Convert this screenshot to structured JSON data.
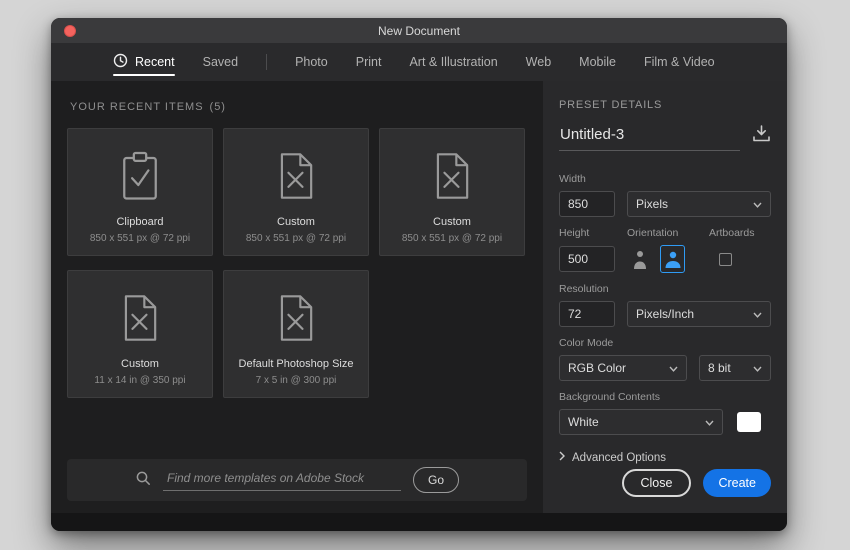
{
  "window": {
    "title": "New Document"
  },
  "tabs": {
    "items": [
      {
        "label": "Recent"
      },
      {
        "label": "Saved"
      },
      {
        "label": "Photo"
      },
      {
        "label": "Print"
      },
      {
        "label": "Art & Illustration"
      },
      {
        "label": "Web"
      },
      {
        "label": "Mobile"
      },
      {
        "label": "Film & Video"
      }
    ]
  },
  "recent": {
    "heading": "YOUR RECENT ITEMS",
    "count": "(5)",
    "items": [
      {
        "title": "Clipboard",
        "subtitle": "850 x 551 px @ 72 ppi",
        "icon": "clipboard-icon"
      },
      {
        "title": "Custom",
        "subtitle": "850 x 551 px @ 72 ppi",
        "icon": "new-document-icon"
      },
      {
        "title": "Custom",
        "subtitle": "850 x 551 px @ 72 ppi",
        "icon": "new-document-icon"
      },
      {
        "title": "Custom",
        "subtitle": "11 x 14 in @ 350 ppi",
        "icon": "new-document-icon"
      },
      {
        "title": "Default Photoshop Size",
        "subtitle": "7 x 5 in @ 300 ppi",
        "icon": "new-document-icon"
      }
    ],
    "search": {
      "placeholder": "Find more templates on Adobe Stock",
      "go_label": "Go"
    }
  },
  "preset": {
    "heading": "PRESET DETAILS",
    "name": "Untitled-3",
    "width": {
      "label": "Width",
      "value": "850",
      "unit": "Pixels"
    },
    "height": {
      "label": "Height",
      "value": "500"
    },
    "orientation": {
      "label": "Orientation",
      "selected": "landscape"
    },
    "artboards": {
      "label": "Artboards",
      "checked": false
    },
    "resolution": {
      "label": "Resolution",
      "value": "72",
      "unit": "Pixels/Inch"
    },
    "color_mode": {
      "label": "Color Mode",
      "value": "RGB Color",
      "bit_depth": "8 bit"
    },
    "background": {
      "label": "Background Contents",
      "value": "White"
    },
    "advanced": {
      "label": "Advanced Options"
    },
    "actions": {
      "close": "Close",
      "create": "Create"
    }
  },
  "colors": {
    "accent_blue": "#1473e6",
    "orientation_selected": "#2f9bf5",
    "background_swatch": "#ffffff"
  }
}
